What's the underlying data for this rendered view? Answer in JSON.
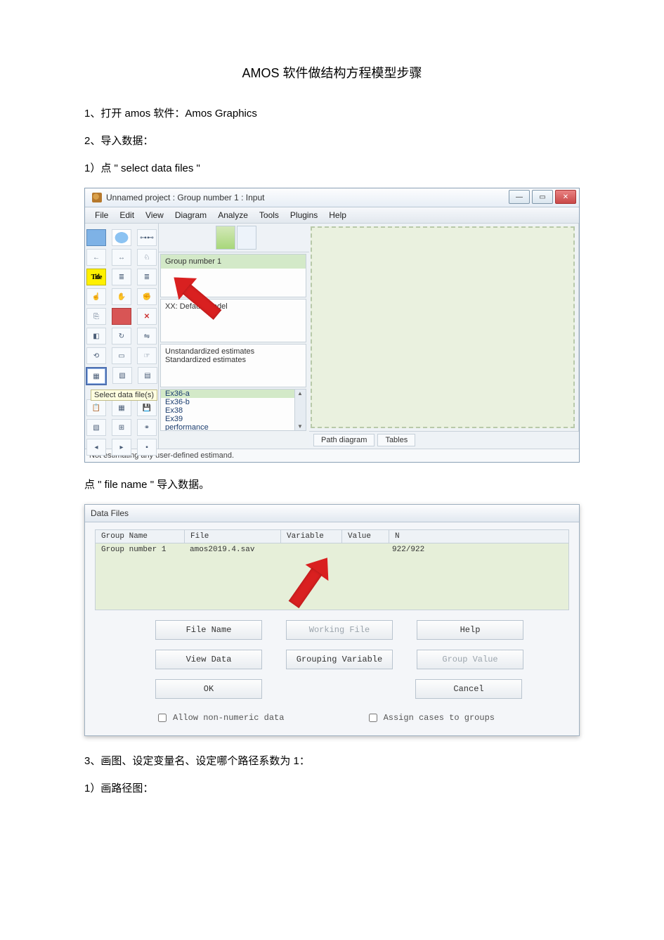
{
  "doc": {
    "title": "AMOS 软件做结构方程模型步骤",
    "p1": "1、打开 amos 软件：Amos Graphics",
    "p2": "2、导入数据：",
    "p3": "1）点 \" select data files \"",
    "p4": "点 \" file name \" 导入数据。",
    "p5": "3、画图、设定变量名、设定哪个路径系数为 1：",
    "p6": "1）画路径图："
  },
  "amos": {
    "window_title": "Unnamed project : Group number 1 : Input",
    "menu": {
      "file": "File",
      "edit": "Edit",
      "view": "View",
      "diagram": "Diagram",
      "analyze": "Analyze",
      "tools": "Tools",
      "plugins": "Plugins",
      "help": "Help"
    },
    "tool_label_title": "Title",
    "tooltip_select_data": "Select data file(s)",
    "panel_group": "Group number 1",
    "panel_model": "XX: Default model",
    "panel_est1": "Unstandardized estimates",
    "panel_est2": "Standardized estimates",
    "files": {
      "a": "Ex36-a",
      "b": "Ex36-b",
      "c": "Ex38",
      "d": "Ex39",
      "e": "performance"
    },
    "tab_path": "Path diagram",
    "tab_tables": "Tables",
    "status": "Not estimating any user-defined estimand."
  },
  "dlg": {
    "title": "Data Files",
    "hd": {
      "group": "Group Name",
      "file": "File",
      "variable": "Variable",
      "value": "Value",
      "n": "N"
    },
    "row": {
      "group": "Group number 1",
      "file": "amos2019.4.sav",
      "n": "922/922"
    },
    "btn": {
      "file_name": "File Name",
      "working": "Working File",
      "help": "Help",
      "view": "View Data",
      "grouping": "Grouping Variable",
      "gval": "Group Value",
      "ok": "OK",
      "cancel": "Cancel"
    },
    "chk": {
      "allow": "Allow non-numeric data",
      "assign": "Assign cases to groups"
    }
  }
}
